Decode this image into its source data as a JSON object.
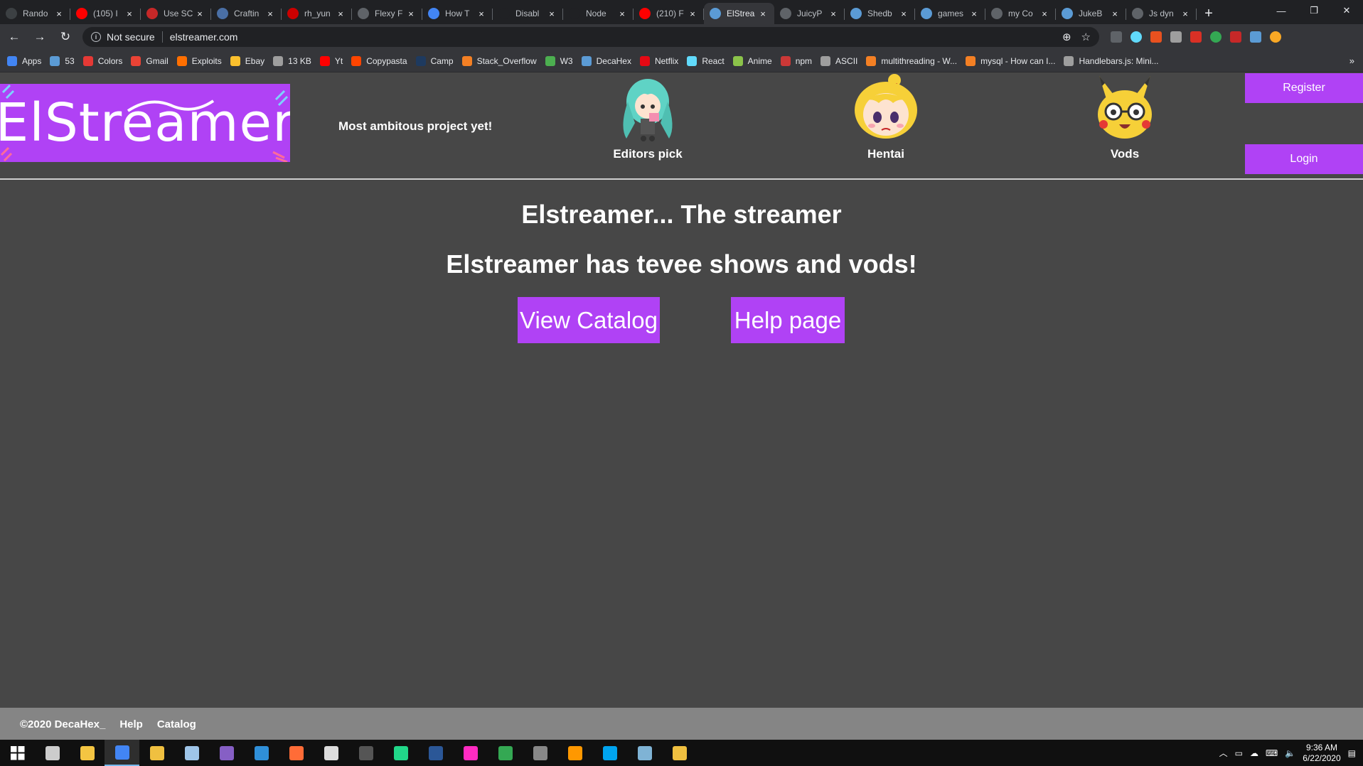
{
  "browser": {
    "tabs": [
      {
        "title": "Rando",
        "color": "#3c4043"
      },
      {
        "title": "(105) I",
        "color": "#ff0000"
      },
      {
        "title": "Use SC",
        "color": "#c62828"
      },
      {
        "title": "Craftin",
        "color": "#4a6fa5"
      },
      {
        "title": "rh_yun",
        "color": "#cc0000"
      },
      {
        "title": "Flexy F",
        "color": "#5f6368"
      },
      {
        "title": "How T",
        "color": "#4285f4"
      },
      {
        "title": "Disabl",
        "color": "#202124"
      },
      {
        "title": "Node",
        "color": "#202124"
      },
      {
        "title": "(210) F",
        "color": "#ff0000"
      },
      {
        "title": "ElStrea",
        "color": "#5b9bd5"
      },
      {
        "title": "JuicyP",
        "color": "#5f6368"
      },
      {
        "title": "Shedb",
        "color": "#5b9bd5"
      },
      {
        "title": "games",
        "color": "#5b9bd5"
      },
      {
        "title": "my Co",
        "color": "#5f6368"
      },
      {
        "title": "JukeB",
        "color": "#5b9bd5"
      },
      {
        "title": "Js dyn",
        "color": "#5f6368"
      }
    ],
    "active_tab_index": 10,
    "new_tab_label": "+",
    "window_controls": {
      "minimize": "—",
      "maximize": "❐",
      "close": "✕"
    },
    "nav": {
      "back": "←",
      "forward": "→",
      "reload": "↻"
    },
    "security_label": "Not secure",
    "url": "elstreamer.com",
    "bookmarks": [
      {
        "label": "Apps",
        "color": "#4285f4"
      },
      {
        "label": "53",
        "color": "#5b9bd5"
      },
      {
        "label": "Colors",
        "color": "#e53935"
      },
      {
        "label": "Gmail",
        "color": "#ea4335"
      },
      {
        "label": "Exploits",
        "color": "#ff6f00"
      },
      {
        "label": "Ebay",
        "color": "#fbc02d"
      },
      {
        "label": "13 KB",
        "color": "#9e9e9e"
      },
      {
        "label": "Yt",
        "color": "#ff0000"
      },
      {
        "label": "Copypasta",
        "color": "#ff4500"
      },
      {
        "label": "Camp",
        "color": "#1e3a5f"
      },
      {
        "label": "Stack_Overflow",
        "color": "#f48024"
      },
      {
        "label": "W3",
        "color": "#4caf50"
      },
      {
        "label": "DecaHex",
        "color": "#5b9bd5"
      },
      {
        "label": "Netflix",
        "color": "#e50914"
      },
      {
        "label": "React",
        "color": "#61dafb"
      },
      {
        "label": "Anime",
        "color": "#8bc34a"
      },
      {
        "label": "npm",
        "color": "#cb3837"
      },
      {
        "label": "ASCII",
        "color": "#9e9e9e"
      },
      {
        "label": "multithreading - W...",
        "color": "#f48024"
      },
      {
        "label": "mysql - How can I...",
        "color": "#f48024"
      },
      {
        "label": "Handlebars.js: Mini...",
        "color": "#9e9e9e"
      }
    ],
    "bookmarks_more": "»"
  },
  "site": {
    "logo_text": "ElStreamer",
    "tagline": "Most ambitous project yet!",
    "nav": [
      {
        "label": "Editors pick",
        "icon": "anime-girl-icon"
      },
      {
        "label": "Hentai",
        "icon": "blonde-character-icon"
      },
      {
        "label": "Vods",
        "icon": "pikachu-glasses-icon"
      }
    ],
    "register_label": "Register",
    "login_label": "Login",
    "hero_title": "Elstreamer... The streamer",
    "hero_subtitle": "Elstreamer has tevee shows and vods!",
    "view_catalog_label": "View Catalog",
    "help_page_label": "Help page",
    "footer": {
      "copyright": "©2020 DecaHex_",
      "help": "Help",
      "catalog": "Catalog"
    },
    "accent_color": "#b042f5",
    "background_color": "#474747"
  },
  "taskbar": {
    "apps": [
      {
        "name": "start-icon",
        "color": "#ffffff"
      },
      {
        "name": "task-view-icon",
        "color": "#cccccc"
      },
      {
        "name": "file-explorer-icon",
        "color": "#f4c542"
      },
      {
        "name": "chrome-icon",
        "color": "#4285f4"
      },
      {
        "name": "git-icon",
        "color": "#f0c040"
      },
      {
        "name": "notepad-icon",
        "color": "#9fc5e8"
      },
      {
        "name": "visual-studio-icon",
        "color": "#865fc5"
      },
      {
        "name": "vscode-icon",
        "color": "#2f8fd8"
      },
      {
        "name": "postman-icon",
        "color": "#ff6c37"
      },
      {
        "name": "unity-icon",
        "color": "#dddddd"
      },
      {
        "name": "terminal-icon",
        "color": "#555555"
      },
      {
        "name": "pycharm-icon",
        "color": "#21d789"
      },
      {
        "name": "powershell-icon",
        "color": "#2b5797"
      },
      {
        "name": "adobe-xd-icon",
        "color": "#ff2bc2"
      },
      {
        "name": "maps-icon",
        "color": "#34a853"
      },
      {
        "name": "davinci-icon",
        "color": "#888888"
      },
      {
        "name": "sublime-icon",
        "color": "#ff9800"
      },
      {
        "name": "azure-icon",
        "color": "#00a4ef"
      },
      {
        "name": "notes-icon",
        "color": "#7fb3d5"
      },
      {
        "name": "git-extensions-icon",
        "color": "#f0c040"
      }
    ],
    "active_app_index": 3,
    "time": "9:36 AM",
    "date": "6/22/2020"
  }
}
